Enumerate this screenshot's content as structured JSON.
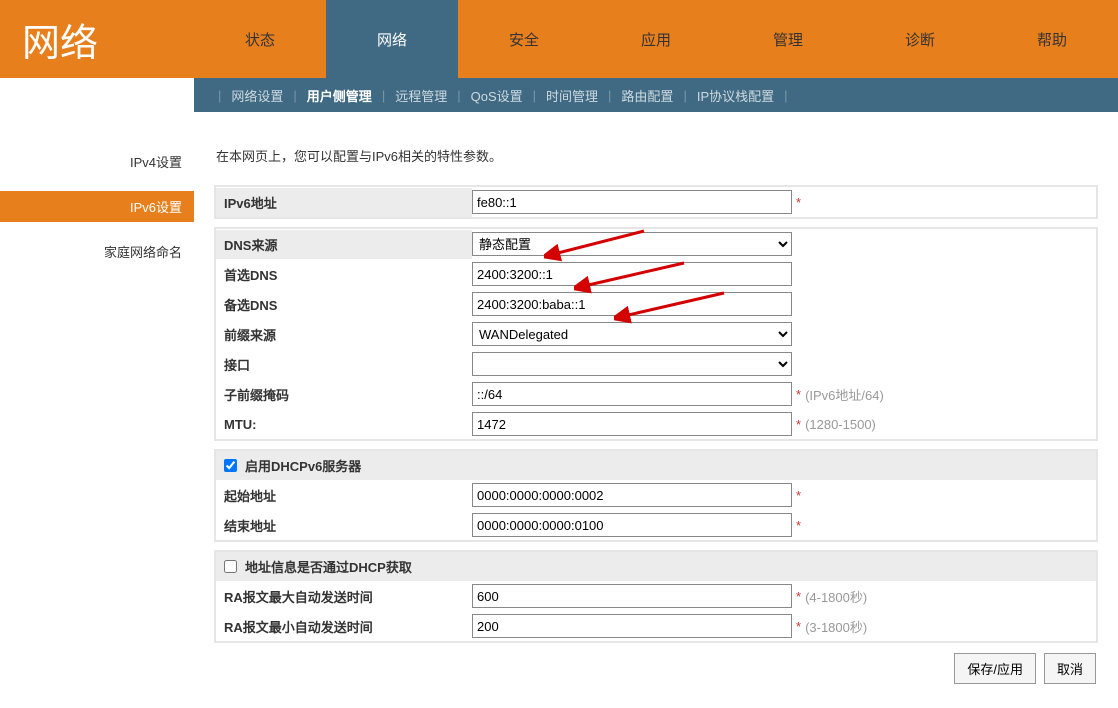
{
  "brand": "网络",
  "tabs": [
    "状态",
    "网络",
    "安全",
    "应用",
    "管理",
    "诊断",
    "帮助"
  ],
  "active_tab": "网络",
  "subnav": [
    "网络设置",
    "用户侧管理",
    "远程管理",
    "QoS设置",
    "时间管理",
    "路由配置",
    "IP协议栈配置"
  ],
  "active_subnav": "用户侧管理",
  "sidebar": [
    "IPv4设置",
    "IPv6设置",
    "家庭网络命名"
  ],
  "active_side": "IPv6设置",
  "intro": "在本网页上，您可以配置与IPv6相关的特性参数。",
  "labels": {
    "ipv6addr": "IPv6地址",
    "dnssrc": "DNS来源",
    "dns1": "首选DNS",
    "dns2": "备选DNS",
    "prefsrc": "前缀来源",
    "iface": "接口",
    "submask": "子前缀掩码",
    "mtu": "MTU:",
    "dhcpv6": "启用DHCPv6服务器",
    "start": "起始地址",
    "end": "结束地址",
    "dhcpinfo": "地址信息是否通过DHCP获取",
    "ramax": "RA报文最大自动发送时间",
    "ramin": "RA报文最小自动发送时间"
  },
  "values": {
    "ipv6addr": "fe80::1",
    "dnssrc": "静态配置",
    "dns1": "2400:3200::1",
    "dns2": "2400:3200:baba::1",
    "prefsrc": "WANDelegated",
    "iface": "",
    "submask": "::/64",
    "mtu": "1472",
    "dhcpv6_checked": true,
    "start": "0000:0000:0000:0002",
    "end": "0000:0000:0000:0100",
    "dhcpinfo_checked": false,
    "ramax": "600",
    "ramin": "200"
  },
  "hints": {
    "submask": "(IPv6地址/64)",
    "mtu": "(1280-1500)",
    "ramax": "(4-1800秒)",
    "ramin": "(3-1800秒)"
  },
  "buttons": {
    "save": "保存/应用",
    "cancel": "取消"
  }
}
